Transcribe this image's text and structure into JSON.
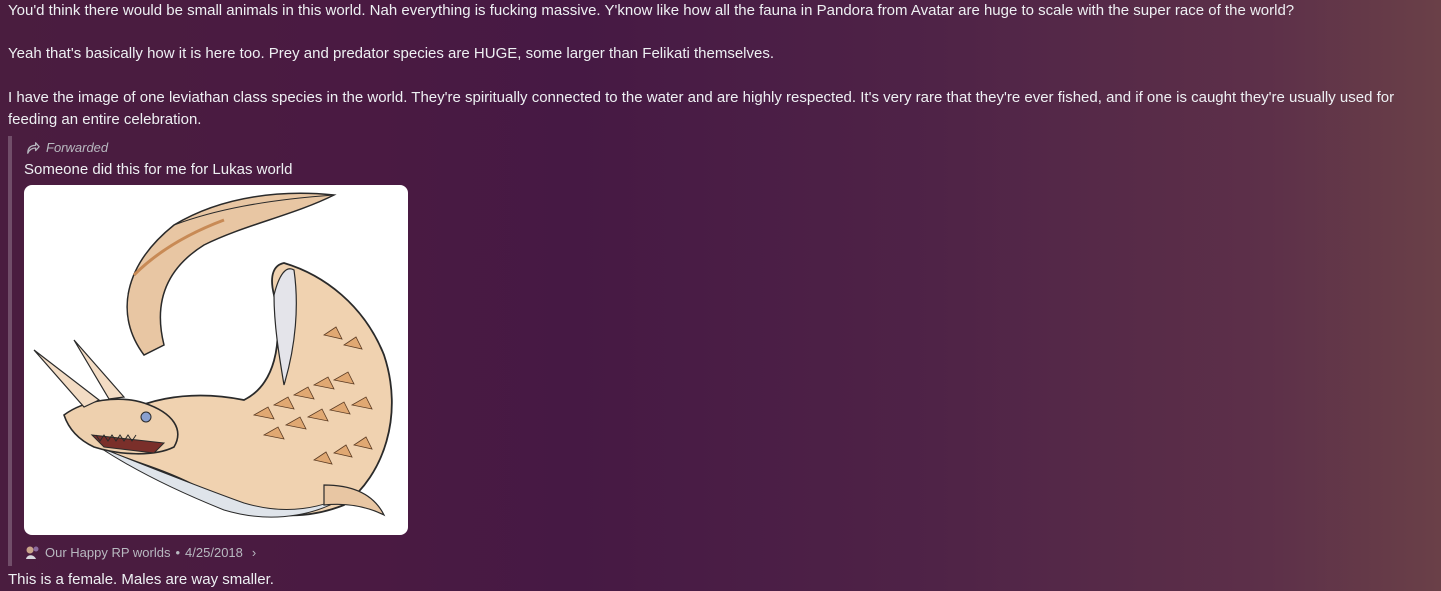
{
  "messages": {
    "line1": "You'd think there would be small animals in this world.  Nah everything is fucking massive. Y'know like how all the fauna in Pandora from Avatar are huge to scale with the super race of the world?",
    "line2": "Yeah that's basically how it is here too.  Prey and predator species are HUGE, some larger than Felikati themselves.",
    "line3": "I have the image of one leviathan class species in the world.  They're spiritually connected to the water and are highly respected.  It's very rare that they're ever fished, and if one is caught they're usually used for feeding an entire celebration.",
    "line4": "This is a female.  Males are way smaller."
  },
  "forward": {
    "label": "Forwarded",
    "text": "Someone did this for me for Lukas world",
    "image_icon": "shark-creature-illustration",
    "server": "Our Happy RP worlds",
    "separator": "•",
    "date": "4/25/2018",
    "chevron": "›"
  }
}
